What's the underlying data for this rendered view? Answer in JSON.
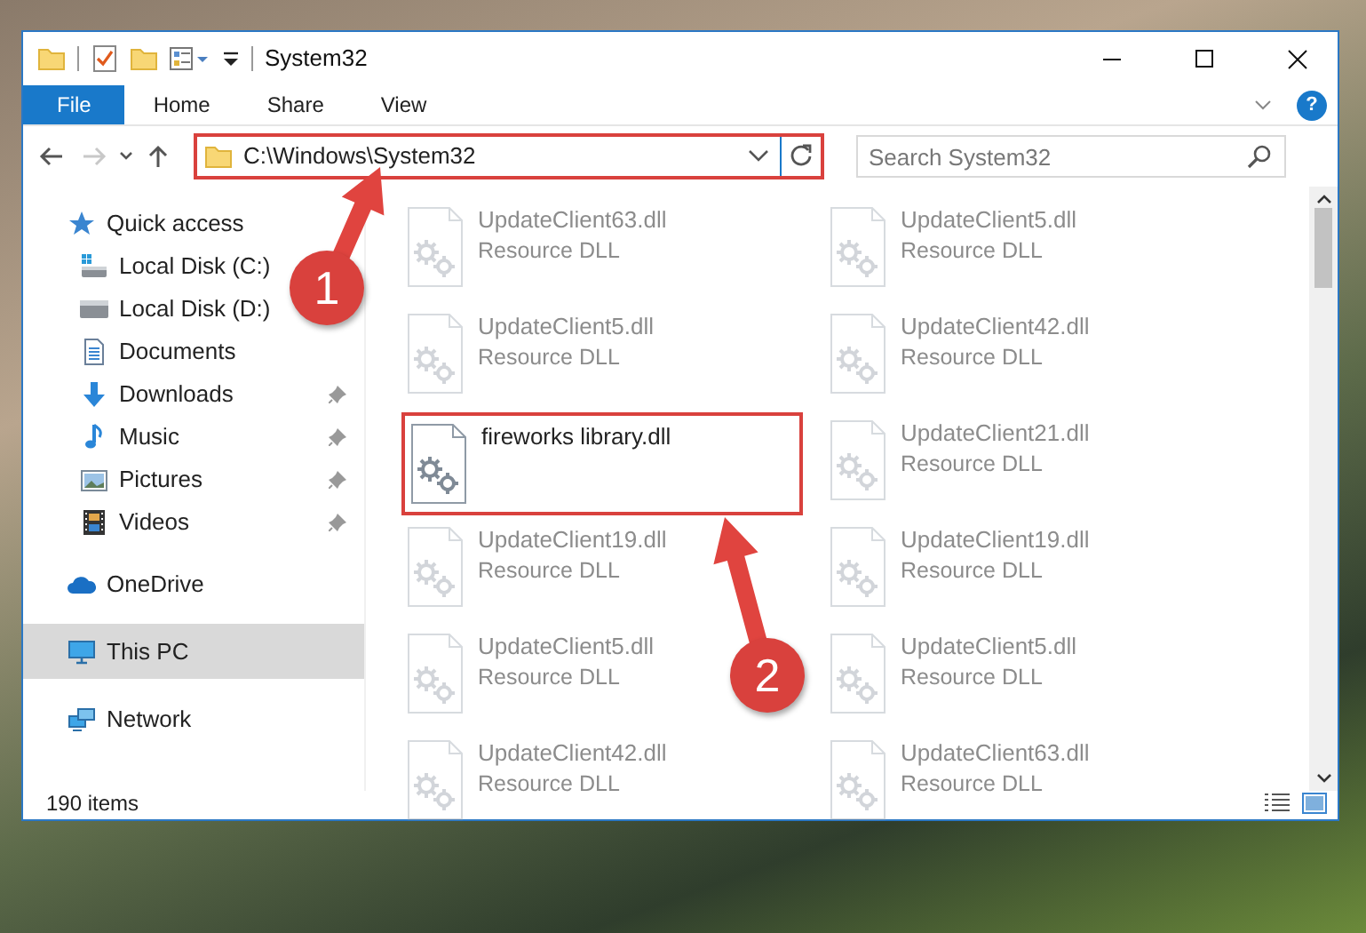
{
  "window": {
    "title": "System32"
  },
  "ribbon": {
    "tabs": [
      {
        "label": "File",
        "kind": "menu",
        "selected": false
      },
      {
        "label": "Home",
        "kind": "tab",
        "selected": false
      },
      {
        "label": "Share",
        "kind": "tab",
        "selected": false
      },
      {
        "label": "View",
        "kind": "tab",
        "selected": false
      }
    ],
    "help": "?"
  },
  "navigation": {
    "back_disabled": false,
    "forward_disabled": true,
    "address": "C:\\Windows\\System32",
    "address_annotated": true,
    "search": {
      "placeholder": "Search System32"
    }
  },
  "sidebar": {
    "items": [
      {
        "label": "Quick access",
        "kind": "star",
        "selected": false,
        "children": [
          {
            "label": "Local Disk (C:)",
            "kind": "system-drive",
            "pinned": false,
            "selected": false
          },
          {
            "label": "Local Disk (D:)",
            "kind": "drive",
            "pinned": false,
            "selected": false
          },
          {
            "label": "Documents",
            "kind": "documents",
            "pinned": false,
            "selected": false
          },
          {
            "label": "Downloads",
            "kind": "downloads",
            "pinned": true,
            "selected": false
          },
          {
            "label": "Music",
            "kind": "music",
            "pinned": true,
            "selected": false
          },
          {
            "label": "Pictures",
            "kind": "pictures",
            "pinned": true,
            "selected": false
          },
          {
            "label": "Videos",
            "kind": "videos",
            "pinned": true,
            "selected": false
          }
        ]
      },
      {
        "label": "OneDrive",
        "kind": "cloud",
        "selected": false
      },
      {
        "label": "This PC",
        "kind": "pc",
        "selected": true
      },
      {
        "label": "Network",
        "kind": "network",
        "selected": false
      }
    ]
  },
  "files": [
    {
      "name": "UpdateClient63.dll",
      "type": "Resource DLL",
      "faded": true,
      "annotated": false
    },
    {
      "name": "UpdateClient5.dll",
      "type": "Resource DLL",
      "faded": true,
      "annotated": false
    },
    {
      "name": "UpdateClient5.dll",
      "type": "Resource DLL",
      "faded": true,
      "annotated": false
    },
    {
      "name": "UpdateClient42.dll",
      "type": "Resource DLL",
      "faded": true,
      "annotated": false
    },
    {
      "name": "fireworks library.dll",
      "faded": false,
      "annotated": true
    },
    {
      "name": "UpdateClient21.dll",
      "type": "Resource DLL",
      "faded": true,
      "annotated": false
    },
    {
      "name": "UpdateClient19.dll",
      "type": "Resource DLL",
      "faded": true,
      "annotated": false
    },
    {
      "name": "UpdateClient19.dll",
      "type": "Resource DLL",
      "faded": true,
      "annotated": false
    },
    {
      "name": "UpdateClient5.dll",
      "type": "Resource DLL",
      "faded": true,
      "annotated": false
    },
    {
      "name": "UpdateClient5.dll",
      "type": "Resource DLL",
      "faded": true,
      "annotated": false
    },
    {
      "name": "UpdateClient42.dll",
      "type": "Resource DLL",
      "faded": true,
      "annotated": false
    },
    {
      "name": "UpdateClient63.dll",
      "type": "Resource DLL",
      "faded": true,
      "annotated": false
    }
  ],
  "status_bar": {
    "item_count": "190 items"
  },
  "callouts": [
    {
      "number": "1"
    },
    {
      "number": "2"
    }
  ]
}
